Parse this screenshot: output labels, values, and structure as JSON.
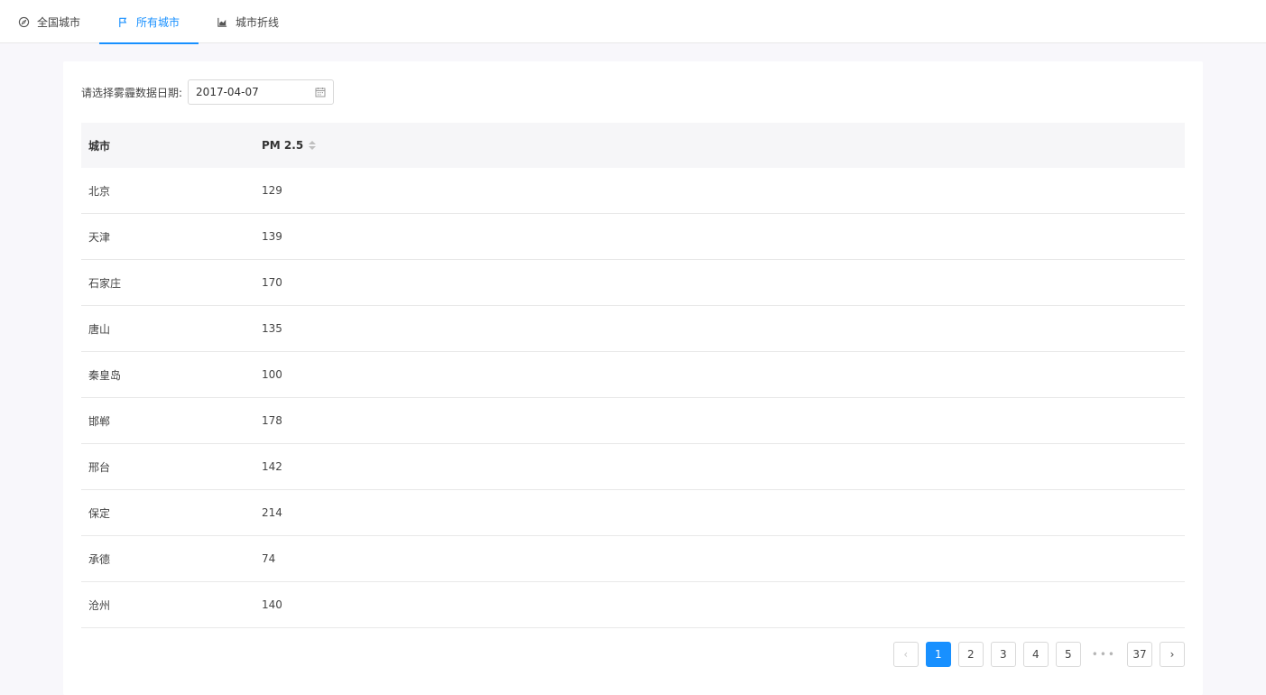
{
  "tabs": [
    {
      "label": "全国城市",
      "icon": "compass-icon",
      "active": false
    },
    {
      "label": "所有城市",
      "icon": "flag-icon",
      "active": true
    },
    {
      "label": "城市折线",
      "icon": "area-chart-icon",
      "active": false
    }
  ],
  "filter": {
    "label": "请选择雾霾数据日期:",
    "date_value": "2017-04-07",
    "icon": "calendar-icon"
  },
  "table": {
    "columns": [
      "城市",
      "PM 2.5"
    ],
    "rows": [
      {
        "city": "北京",
        "pm25": "129"
      },
      {
        "city": "天津",
        "pm25": "139"
      },
      {
        "city": "石家庄",
        "pm25": "170"
      },
      {
        "city": "唐山",
        "pm25": "135"
      },
      {
        "city": "秦皇岛",
        "pm25": "100"
      },
      {
        "city": "邯郸",
        "pm25": "178"
      },
      {
        "city": "邢台",
        "pm25": "142"
      },
      {
        "city": "保定",
        "pm25": "214"
      },
      {
        "city": "承德",
        "pm25": "74"
      },
      {
        "city": "沧州",
        "pm25": "140"
      }
    ]
  },
  "pagination": {
    "prev": "‹",
    "next": "›",
    "pages": [
      "1",
      "2",
      "3",
      "4",
      "5"
    ],
    "ellipsis": "•••",
    "last": "37",
    "current": "1"
  },
  "colors": {
    "accent": "#1890ff",
    "border": "#e8e8e8",
    "background": "#f8f7fb"
  }
}
